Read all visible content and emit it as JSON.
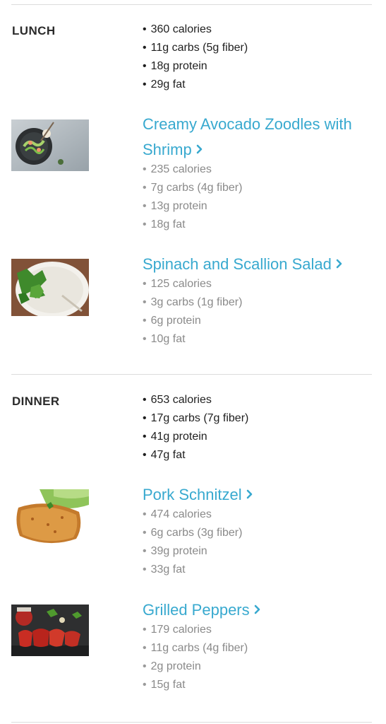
{
  "accent_color": "#38a9cf",
  "meals": [
    {
      "label": "LUNCH",
      "summary": [
        "360 calories",
        "11g carbs (5g fiber)",
        "18g protein",
        "29g fat"
      ],
      "recipes": [
        {
          "title": "Creamy Avocado Zoodles with Shrimp",
          "image": "zoodles-dish-photo",
          "stats": [
            "235 calories",
            "7g carbs (4g fiber)",
            "13g protein",
            "18g fat"
          ]
        },
        {
          "title": "Spinach and Scallion Salad",
          "image": "salad-bowl-photo",
          "stats": [
            "125 calories",
            "3g carbs (1g fiber)",
            "6g protein",
            "10g fat"
          ]
        }
      ]
    },
    {
      "label": "DINNER",
      "summary": [
        "653 calories",
        "17g carbs (7g fiber)",
        "41g protein",
        "47g fat"
      ],
      "recipes": [
        {
          "title": "Pork Schnitzel",
          "image": "schnitzel-photo",
          "stats": [
            "474 calories",
            "6g carbs (3g fiber)",
            "39g protein",
            "33g fat"
          ]
        },
        {
          "title": "Grilled Peppers",
          "image": "grilled-peppers-photo",
          "stats": [
            "179 calories",
            "11g carbs (4g fiber)",
            "2g protein",
            "15g fat"
          ]
        }
      ]
    }
  ]
}
